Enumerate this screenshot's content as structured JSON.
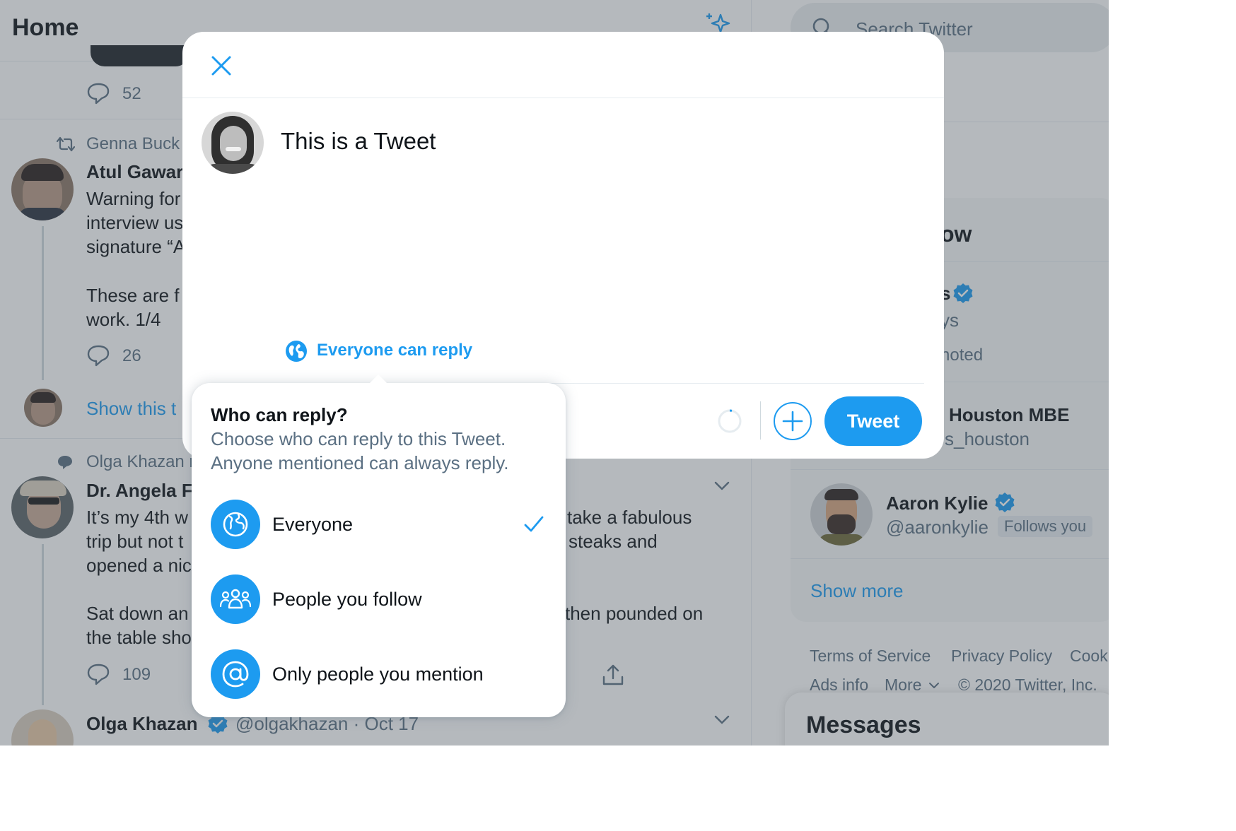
{
  "header": {
    "title": "Home"
  },
  "search": {
    "placeholder": "Search Twitter"
  },
  "timeline": {
    "tweet0": {
      "replies": "52"
    },
    "tweet1": {
      "retweeted_by": "Genna Buck",
      "author": "Atul Gawar",
      "lines": [
        "Warning for",
        "interview us",
        "signature “A",
        "These are f",
        "work. 1/4"
      ],
      "replies": "26",
      "show_thread": "Show this t"
    },
    "tweet2": {
      "context": "Olga Khazan r",
      "author": "Dr. Angela F",
      "lines_left": [
        "It’s my 4th w",
        "trip but not t",
        "opened a nic",
        "Sat down an",
        "the table sho"
      ],
      "lines_right": [
        "take a fabulous",
        "steaks and",
        "then pounded on"
      ],
      "replies": "109"
    },
    "tweet3": {
      "author": "Olga Khazan",
      "handle_date": "@olgakhazan · Oct 17"
    }
  },
  "sidebar": {
    "wtf_title_fragment": "ow",
    "s1_frag_name": "s",
    "s1_frag_handle": "ys",
    "s1_frag_promoted": "noted",
    "houston": {
      "name": "Houston MBE",
      "handle": "s_houston"
    },
    "aaron": {
      "name": "Aaron Kylie",
      "handle": "@aaronkylie",
      "follows_you": "Follows you"
    },
    "show_more": "Show more",
    "footer": {
      "terms": "Terms of Service",
      "privacy": "Privacy Policy",
      "cookie": "Cook",
      "ads": "Ads info",
      "more": "More",
      "copyright": "© 2020 Twitter, Inc."
    },
    "messages": "Messages"
  },
  "composer": {
    "text": "This is a Tweet",
    "reply_setting": "Everyone can reply",
    "tweet_button": "Tweet"
  },
  "reply_popover": {
    "title": "Who can reply?",
    "description_line1": "Choose who can reply to this Tweet.",
    "description_line2": "Anyone mentioned can always reply.",
    "options": [
      {
        "label": "Everyone",
        "icon": "globe-icon",
        "selected": true
      },
      {
        "label": "People you follow",
        "icon": "people-icon",
        "selected": false
      },
      {
        "label": "Only people you mention",
        "icon": "at-sign-icon",
        "selected": false
      }
    ]
  },
  "colors": {
    "accent": "#1d9bf0",
    "text": "#0f1419",
    "muted": "#5b7083"
  }
}
